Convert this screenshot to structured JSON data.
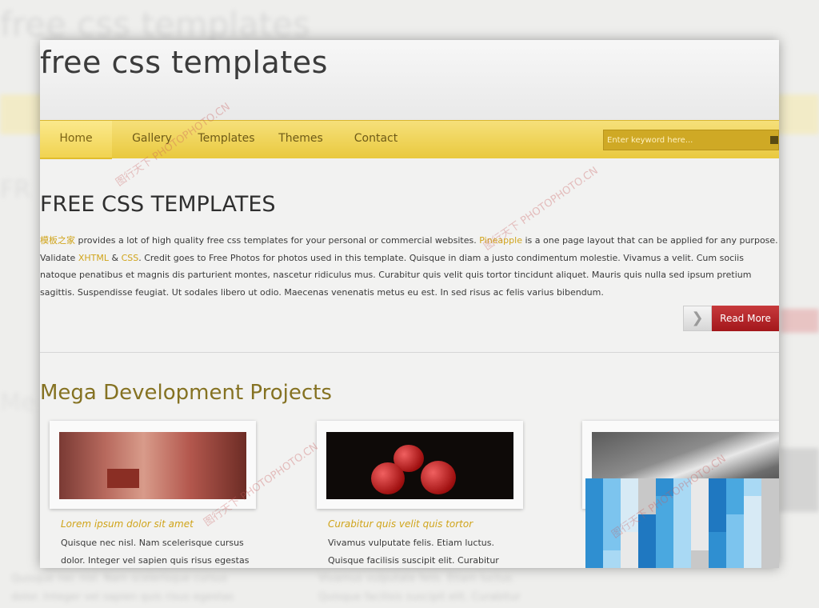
{
  "site": {
    "title": "free css templates"
  },
  "nav": {
    "items": [
      {
        "label": "Home",
        "active": true
      },
      {
        "label": "Gallery",
        "active": false
      },
      {
        "label": "Templates",
        "active": false
      },
      {
        "label": "Themes",
        "active": false
      },
      {
        "label": "Contact",
        "active": false
      }
    ],
    "search_placeholder": "Enter keyword here..."
  },
  "main": {
    "heading": "FREE CSS TEMPLATES",
    "intro_link1": "模板之家",
    "intro_text1": " provides a lot of high quality free css templates for your personal or commercial websites. ",
    "intro_link2": "Pineapple",
    "intro_text2": " is a one page layout that can be applied for any purpose. Validate ",
    "intro_link3": "XHTML",
    "intro_text3": " & ",
    "intro_link4": "CSS",
    "intro_text4": ". Credit goes to Free Photos for photos used in this template. Quisque in diam a justo condimentum molestie. Vivamus a velit. Cum sociis natoque penatibus et magnis dis parturient montes, nascetur ridiculus mus. Curabitur quis velit quis tortor tincidunt aliquet. Mauris quis nulla sed ipsum pretium sagittis. Suspendisse feugiat. Ut sodales libero ut odio. Maecenas venenatis metus eu est. In sed risus ac felis varius bibendum.",
    "arrow_icon": "chevron-right-icon",
    "read_more": "Read More"
  },
  "projects": {
    "heading": "Mega Development Projects",
    "items": [
      {
        "title": "Lorem ipsum dolor sit amet",
        "text": "Quisque nec nisl. Nam scelerisque cursus dolor. Integer vel sapien quis risus egestas"
      },
      {
        "title": "Curabitur quis velit quis tortor",
        "text": "Vivamus vulputate felis. Etiam luctus. Quisque facilisis suscipit elit. Curabitur eleifend congue"
      },
      {
        "title": "",
        "text": ""
      }
    ]
  },
  "colors": {
    "nav_yellow": "#e9c93e",
    "accent_gold": "#d0a41a",
    "read_more_red": "#a3171b",
    "section_heading": "#857222"
  },
  "watermark": {
    "brand": "图行天下",
    "url": "PHOTOPHOTO.CN"
  }
}
